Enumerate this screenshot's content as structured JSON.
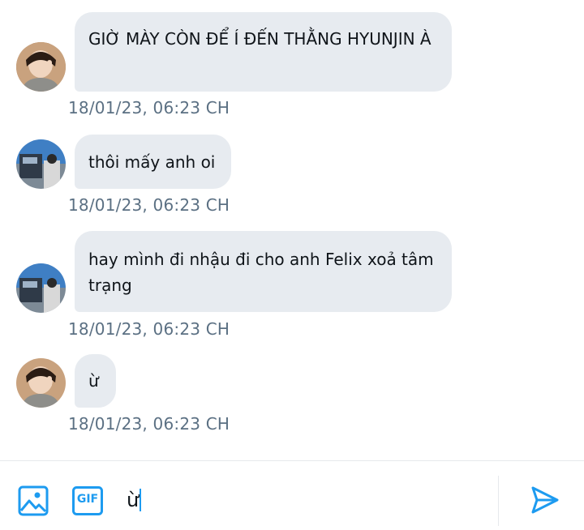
{
  "messages": [
    {
      "avatar": "avatar-boy-portrait",
      "text": "GIỜ MÀY CÒN ĐỂ Í ĐẾN THẰNG HYUNJIN À",
      "time": "18/01/23,  06:23 CH"
    },
    {
      "avatar": "avatar-landscape",
      "text": "thôi mấy anh oi",
      "time": "18/01/23,  06:23 CH"
    },
    {
      "avatar": "avatar-landscape",
      "text": "hay mình đi nhậu đi cho anh Felix xoả tâm trạng",
      "time": "18/01/23,  06:23 CH"
    },
    {
      "avatar": "avatar-boy-portrait",
      "text": "ừ",
      "time": "18/01/23,  06:23 CH"
    }
  ],
  "composer": {
    "input_value": "ừ",
    "gif_label": "GIF",
    "icons": {
      "media": "image-icon",
      "gif": "gif-icon",
      "send": "send-icon"
    },
    "accent": "#1d9bf0"
  }
}
